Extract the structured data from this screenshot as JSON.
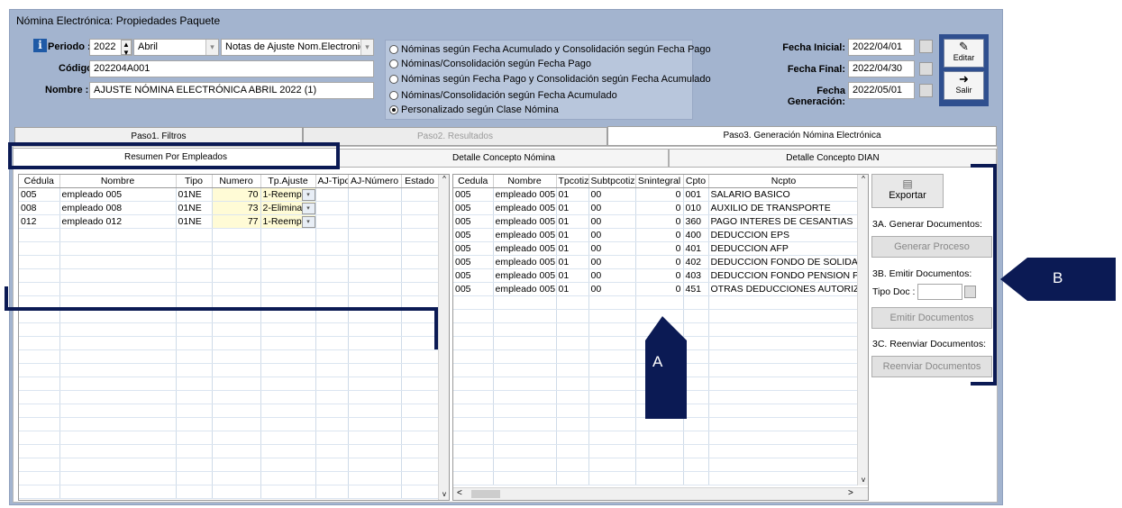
{
  "window": {
    "title": "Nómina Electrónica: Propiedades Paquete"
  },
  "header": {
    "periodo_label": "Periodo :",
    "periodo_year": "2022",
    "periodo_month": "Abril",
    "tipo_value": "Notas de Ajuste Nom.Electronica",
    "codigo_label": "Código :",
    "codigo_value": "202204A001",
    "nombre_label": "Nombre :",
    "nombre_value": "AJUSTE NÓMINA ELECTRÓNICA ABRIL 2022 (1)"
  },
  "radios": [
    {
      "label": "Nóminas según Fecha Acumulado y Consolidación según Fecha Pago",
      "selected": false
    },
    {
      "label": "Nóminas/Consolidación según Fecha Pago",
      "selected": false
    },
    {
      "label": "Nóminas según Fecha Pago y Consolidación según Fecha Acumulado",
      "selected": false
    },
    {
      "label": "Nóminas/Consolidación según Fecha Acumulado",
      "selected": false
    },
    {
      "label": "Personalizado según Clase Nómina",
      "selected": true
    }
  ],
  "dates": {
    "inicial_label": "Fecha Inicial:",
    "inicial_value": "2022/04/01",
    "final_label": "Fecha Final:",
    "final_value": "2022/04/30",
    "generacion_label": "Fecha Generación:",
    "generacion_value": "2022/05/01"
  },
  "toolbar": {
    "editar_label": "Editar",
    "salir_label": "Salir"
  },
  "tabs": [
    "Paso1. Filtros",
    "Paso2. Resultados",
    "Paso3. Generación Nómina Electrónica"
  ],
  "subtabs": [
    "Resumen Por Empleados",
    "Detalle Concepto Nómina",
    "Detalle Concepto DIAN"
  ],
  "left_grid": {
    "headers": [
      "Cédula",
      "Nombre",
      "Tipo",
      "Numero",
      "Tp.Ajuste",
      "AJ-Tipo",
      "AJ-Número",
      "Estado"
    ],
    "rows": [
      [
        "005",
        "empleado 005",
        "01NE",
        "70",
        "1-Reemp"
      ],
      [
        "008",
        "empleado 008",
        "01NE",
        "73",
        "2-Elimina"
      ],
      [
        "012",
        "empleado 012",
        "01NE",
        "77",
        "1-Reemp"
      ]
    ]
  },
  "right_grid": {
    "headers": [
      "Cedula",
      "Nombre",
      "Tpcotiz",
      "Subtpcotiz",
      "Snintegral",
      "Cpto",
      "Ncpto"
    ],
    "rows": [
      [
        "005",
        "empleado 005",
        "01",
        "00",
        "0",
        "001",
        "SALARIO BASICO"
      ],
      [
        "005",
        "empleado 005",
        "01",
        "00",
        "0",
        "010",
        "AUXILIO DE TRANSPORTE"
      ],
      [
        "005",
        "empleado 005",
        "01",
        "00",
        "0",
        "360",
        "PAGO INTERES DE CESANTIAS"
      ],
      [
        "005",
        "empleado 005",
        "01",
        "00",
        "0",
        "400",
        "DEDUCCION EPS"
      ],
      [
        "005",
        "empleado 005",
        "01",
        "00",
        "0",
        "401",
        "DEDUCCION AFP"
      ],
      [
        "005",
        "empleado 005",
        "01",
        "00",
        "0",
        "402",
        "DEDUCCION FONDO DE SOLIDARID"
      ],
      [
        "005",
        "empleado 005",
        "01",
        "00",
        "0",
        "403",
        "DEDUCCION FONDO PENSION PARA"
      ],
      [
        "005",
        "empleado 005",
        "01",
        "00",
        "0",
        "451",
        "OTRAS DEDUCCIONES AUTORIZAD"
      ]
    ]
  },
  "side_panel": {
    "exportar": "Exportar",
    "generar_title": "3A. Generar Documentos:",
    "generar_btn": "Generar Proceso",
    "emitir_title": "3B. Emitir Documentos:",
    "tipo_doc_label": "Tipo Doc :",
    "emitir_btn": "Emitir Documentos",
    "reenviar_title": "3C. Reenviar Documentos:",
    "reenviar_btn": "Reenviar Documentos"
  },
  "annotations": {
    "a": "A",
    "b": "B"
  },
  "colors": {
    "window_bg": "#a3b4cf",
    "callout": "#0b1a54",
    "highlight_cell": "#fffbd6"
  }
}
